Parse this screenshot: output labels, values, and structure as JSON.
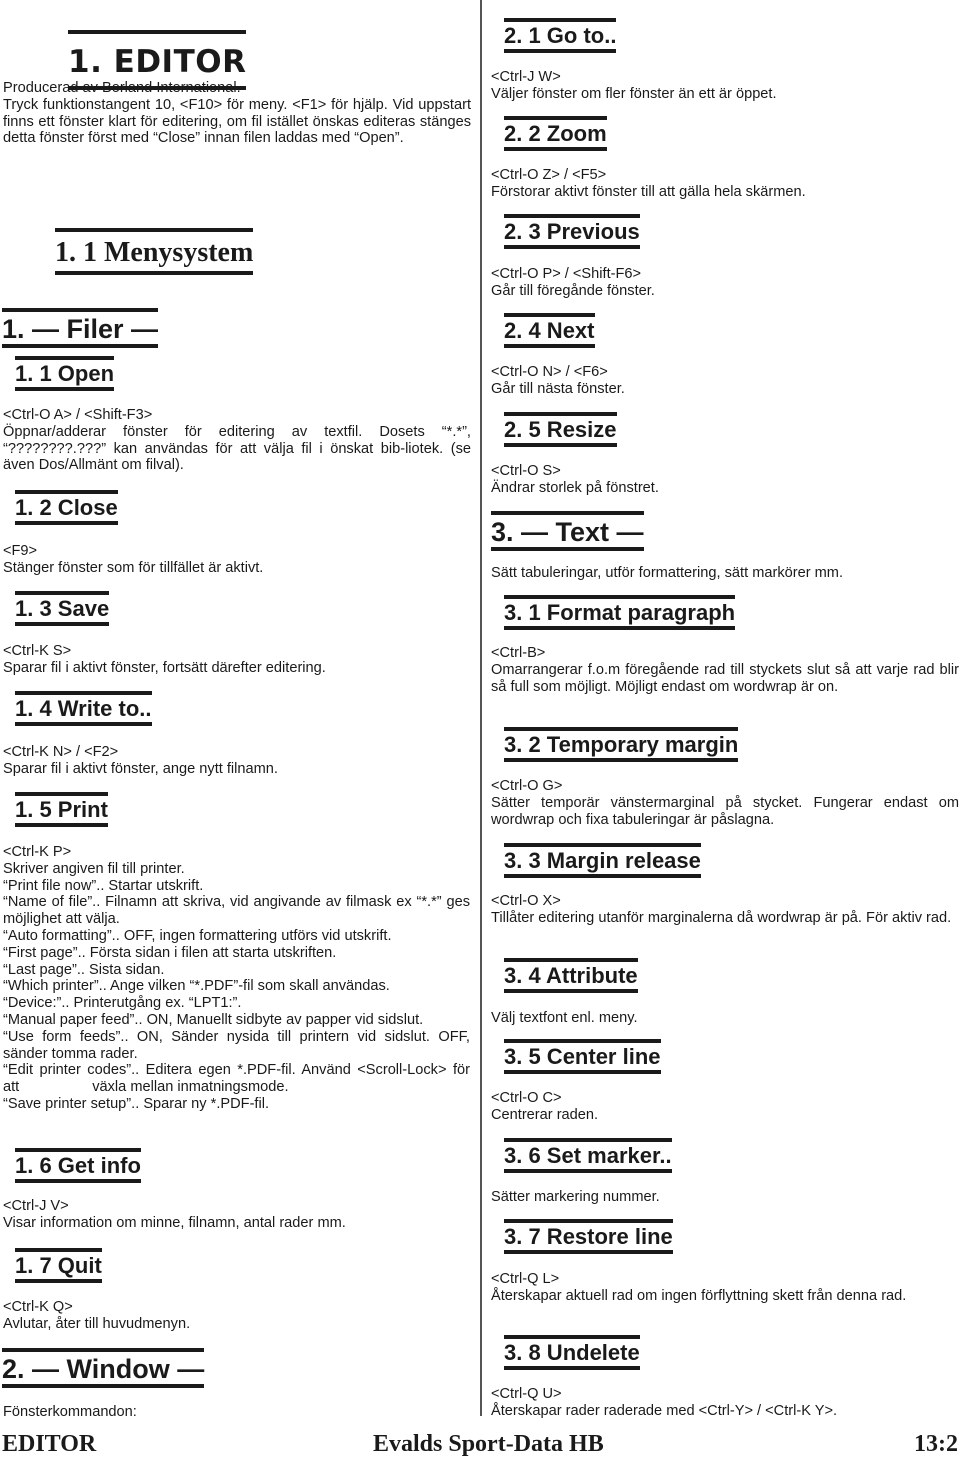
{
  "chapter": {
    "title": "1. EDITOR",
    "intro": [
      "Producerad av Borland International.",
      "Tryck funktionstangent 10, <F10> för meny. <F1> för hjälp. Vid uppstart finns ett fönster klart för editering, om fil istället önskas editeras stänges detta fönster först med “Close” innan filen laddas med “Open”."
    ],
    "menu_heading": "1. 1 Menysystem"
  },
  "sections": {
    "filer": {
      "heading": "1. — Filer —",
      "items": [
        {
          "heading": "1. 1 Open",
          "keys": "<Ctrl-O A> / <Shift-F3>",
          "text": "Öppnar/adderar fönster för editering av textfil. Dosets “*.*”, “????????.???” kan användas för att välja fil i önskat bib-liotek. (se även Dos/Allmänt om filval)."
        },
        {
          "heading": "1. 2 Close",
          "keys": "<F9>",
          "text": "Stänger fönster som för tillfället är aktivt."
        },
        {
          "heading": "1. 3 Save",
          "keys": "<Ctrl-K S>",
          "text": "Sparar fil i aktivt fönster, fortsätt därefter editering."
        },
        {
          "heading": "1. 4 Write to..",
          "keys": "<Ctrl-K N> / <F2>",
          "text": "Sparar fil i aktivt fönster, ange nytt filnamn."
        },
        {
          "heading": "1. 5 Print",
          "keys": "<Ctrl-K P>",
          "lines": [
            "Skriver angiven fil till printer.",
            "“Print file now”.. Startar utskrift.",
            "“Name of file”.. Filnamn att skriva, vid angivande av  filmask ex “*.*” ges möjlighet att välja.",
            "“Auto formatting”.. OFF, ingen formattering utförs vid utskrift.",
            "“First page”.. Första sidan i filen att starta utskriften.",
            "“Last page”.. Sista sidan.",
            "“Which printer”.. Ange vilken “*.PDF”-fil som skall användas.",
            "“Device:”.. Printerutgång ex. “LPT1:”.",
            "“Manual paper feed”.. ON, Manuellt sidbyte av papper vid sidslut.",
            "“Use form feeds”.. ON, Sänder nysida till printern vid sidslut. OFF, sänder tomma rader.",
            "“Edit printer codes”.. Editera egen *.PDF-fil. Använd <Scroll-Lock> för att                  växla mellan inmatningsmode.",
            "“Save printer setup”.. Sparar ny *.PDF-fil."
          ]
        },
        {
          "heading": "1. 6 Get info",
          "keys": "<Ctrl-J V>",
          "text": "Visar information om minne, filnamn, antal rader mm."
        },
        {
          "heading": "1. 7 Quit",
          "keys": "<Ctrl-K Q>",
          "text": "Avlutar, åter till huvudmenyn."
        }
      ]
    },
    "window": {
      "heading": "2. — Window —",
      "intro": "Fönsterkommandon:",
      "items": [
        {
          "heading": "2. 1 Go to..",
          "keys": "<Ctrl-J W>",
          "text": "Väljer fönster om fler fönster än ett är öppet."
        },
        {
          "heading": "2. 2 Zoom",
          "keys": "<Ctrl-O Z> / <F5>",
          "text": "Förstorar aktivt fönster till att gälla hela skärmen."
        },
        {
          "heading": "2. 3 Previous",
          "keys": "<Ctrl-O P> / <Shift-F6>",
          "text": "Går till föregånde fönster."
        },
        {
          "heading": "2. 4 Next",
          "keys": "<Ctrl-O N> / <F6>",
          "text": "Går till nästa fönster."
        },
        {
          "heading": "2. 5 Resize",
          "keys": "<Ctrl-O S>",
          "text": "Ändrar storlek på fönstret."
        }
      ]
    },
    "text": {
      "heading": "3. — Text —",
      "intro": "Sätt tabuleringar, utför formattering, sätt markörer mm.",
      "items": [
        {
          "heading": "3. 1 Format paragraph",
          "keys": "<Ctrl-B>",
          "text": "Omarrangerar f.o.m föregående rad till styckets slut så att varje rad blir så full som möjligt. Möjligt endast om wordwrap är on."
        },
        {
          "heading": "3. 2 Temporary margin",
          "keys": "<Ctrl-O G>",
          "text": "Sätter temporär vänstermarginal på stycket. Fungerar endast om wordwrap och fixa tabuleringar är påslagna."
        },
        {
          "heading": "3. 3 Margin release",
          "keys": "<Ctrl-O X>",
          "text": "Tillåter editering utanför marginalerna då wordwrap är på. För aktiv rad."
        },
        {
          "heading": "3. 4 Attribute",
          "text": "Välj textfont enl. meny."
        },
        {
          "heading": "3. 5 Center line",
          "keys": "<Ctrl-O C>",
          "text": "Centrerar raden."
        },
        {
          "heading": "3. 6 Set marker..",
          "text": "Sätter markering nummer."
        },
        {
          "heading": "3. 7 Restore line",
          "keys": "<Ctrl-Q L>",
          "text": "Återskapar aktuell rad om ingen förflyttning skett från denna rad."
        },
        {
          "heading": "3. 8 Undelete",
          "keys": "<Ctrl-Q U>",
          "text": "Återskapar rader raderade med <Ctrl-Y> / <Ctrl-K Y>."
        }
      ]
    }
  },
  "footer": {
    "left": "EDITOR",
    "center": "Evalds Sport-Data HB",
    "right": "13:2"
  }
}
